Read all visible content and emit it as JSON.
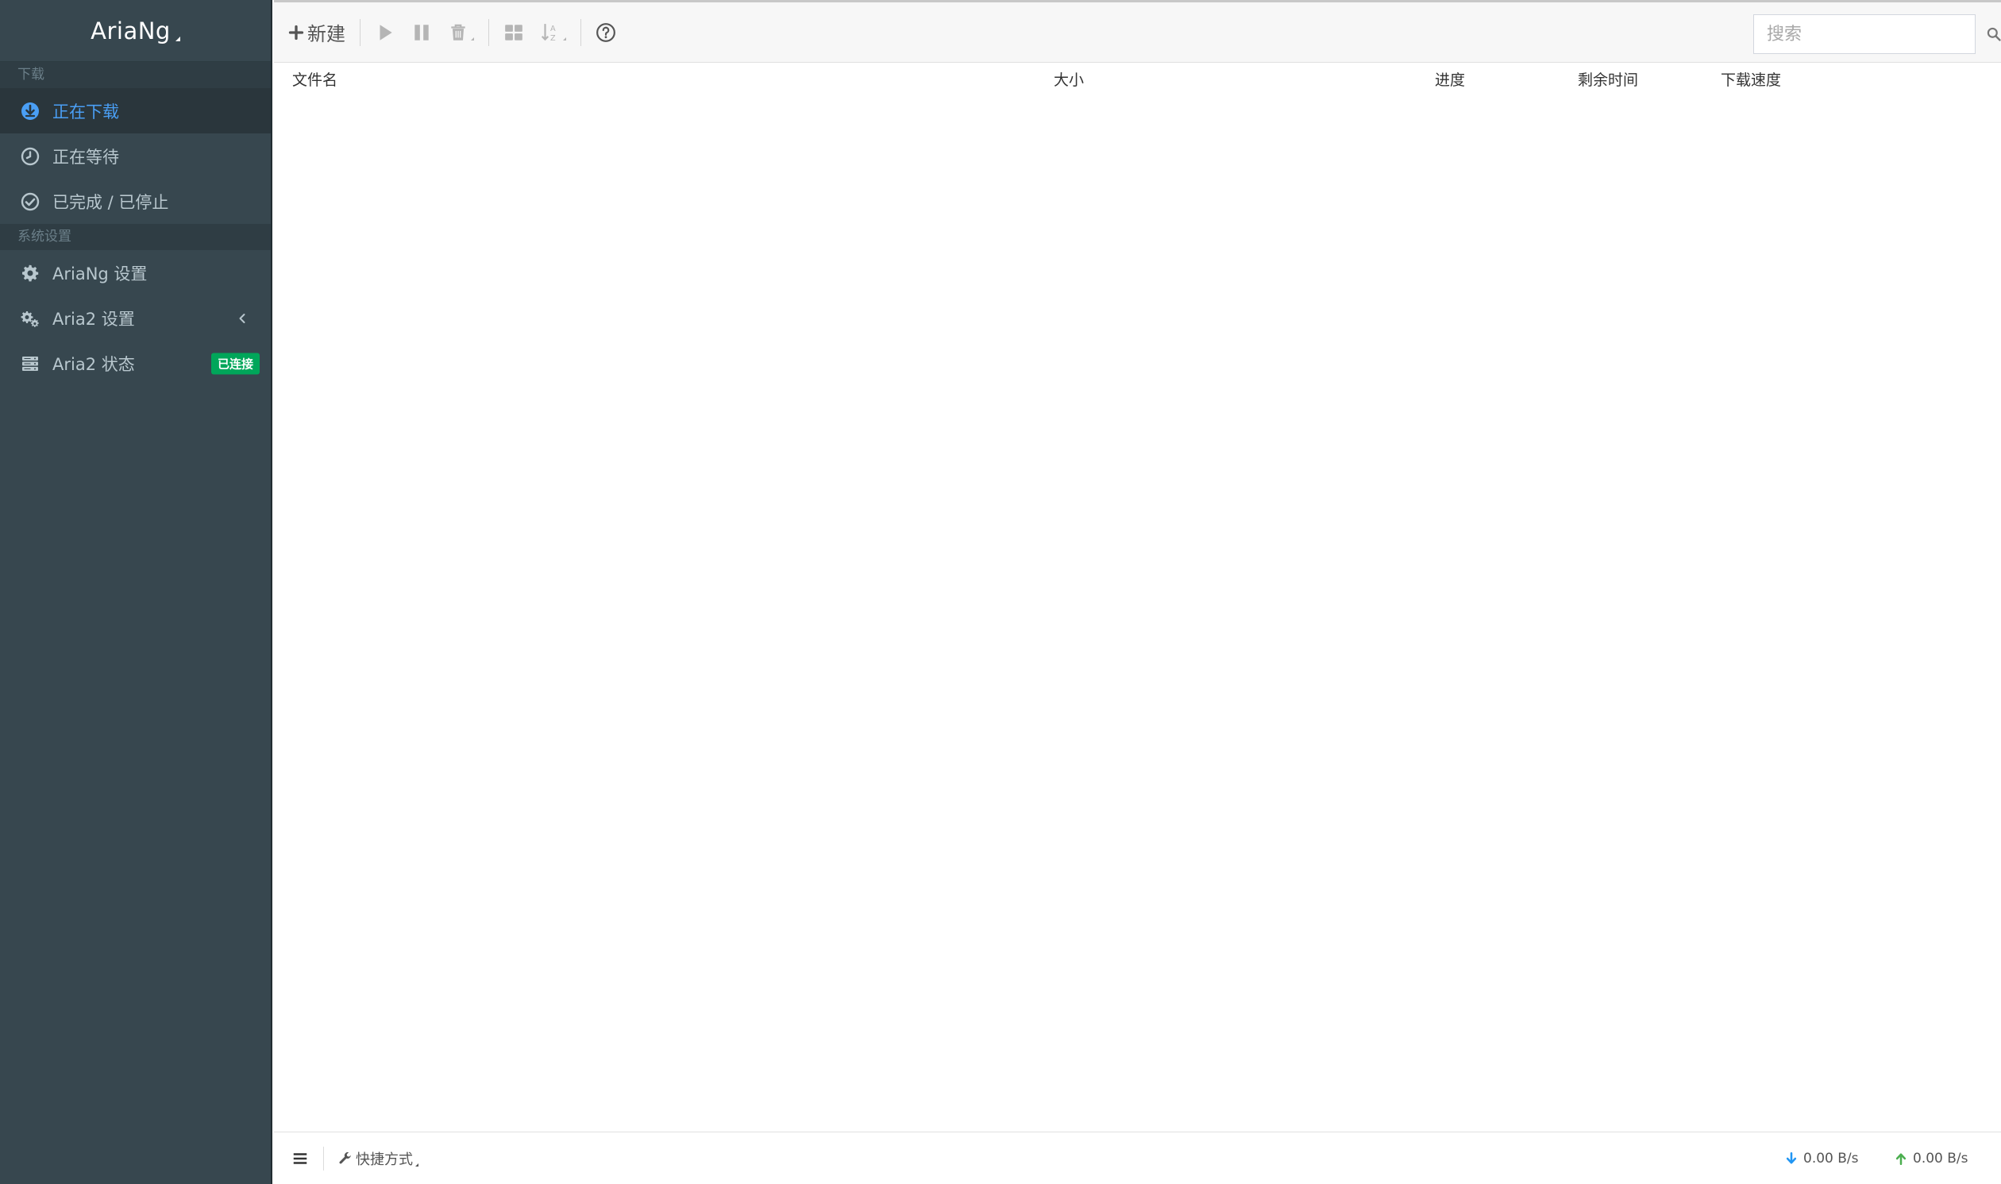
{
  "app": {
    "brand": "AriaNg",
    "colors": {
      "sidebar_bg": "#37474f",
      "active": "#4a9ff5",
      "badge": "#00a65a",
      "upload": "#4caf50",
      "download": "#2196f3"
    }
  },
  "sidebar": {
    "section_download": "下载",
    "items_download": [
      {
        "label": "正在下载",
        "icon": "download-circle-icon",
        "active": true
      },
      {
        "label": "正在等待",
        "icon": "clock-icon",
        "active": false
      },
      {
        "label": "已完成 / 已停止",
        "icon": "check-circle-icon",
        "active": false
      }
    ],
    "section_settings": "系统设置",
    "items_settings": [
      {
        "label": "AriaNg 设置",
        "icon": "gear-icon"
      },
      {
        "label": "Aria2 设置",
        "icon": "gears-icon",
        "has_submenu": true
      },
      {
        "label": "Aria2 状态",
        "icon": "server-icon",
        "badge": "已连接"
      }
    ]
  },
  "toolbar": {
    "new_label": "新建",
    "search_placeholder": "搜索"
  },
  "table": {
    "columns": [
      "文件名",
      "大小",
      "进度",
      "剩余时间",
      "下载速度"
    ]
  },
  "footer": {
    "shortcut_label": "快捷方式",
    "download_speed": "0.00 B/s",
    "upload_speed": "0.00 B/s"
  }
}
